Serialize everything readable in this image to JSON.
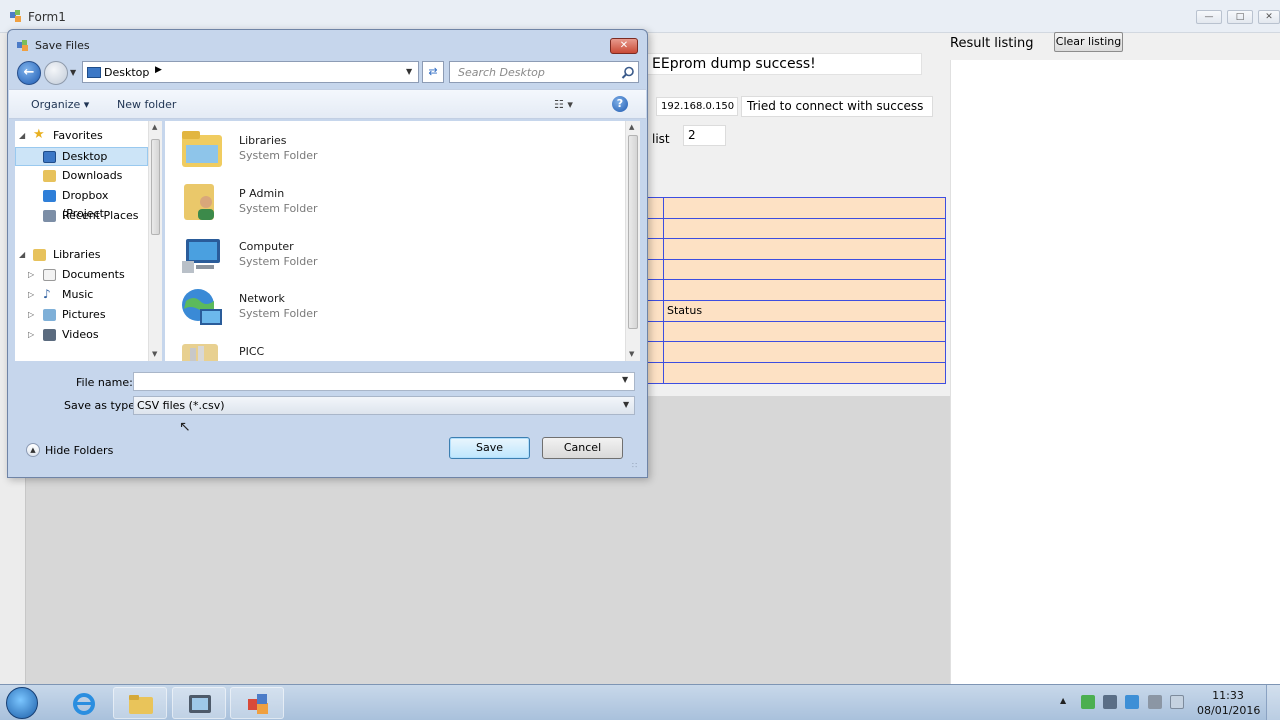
{
  "form1": {
    "title": "Form1",
    "status_message": "EEprom dump success!",
    "ip_address": "192.168.0.150",
    "connection_status": "Tried to connect with success",
    "list_label": "list",
    "list_value": "2",
    "grid_status_header": "Status",
    "result_label": "Result listing",
    "clear_button": "Clear listing"
  },
  "dialog": {
    "title": "Save Files",
    "address": "Desktop",
    "search_placeholder": "Search Desktop",
    "organize": "Organize",
    "new_folder": "New folder",
    "nav": {
      "favorites": "Favorites",
      "desktop": "Desktop",
      "downloads": "Downloads",
      "dropbox": "Dropbox (Project",
      "recent": "Recent Places",
      "libraries": "Libraries",
      "documents": "Documents",
      "music": "Music",
      "pictures": "Pictures",
      "videos": "Videos"
    },
    "files": [
      {
        "name": "Libraries",
        "type": "System Folder"
      },
      {
        "name": "P Admin",
        "type": "System Folder"
      },
      {
        "name": "Computer",
        "type": "System Folder"
      },
      {
        "name": "Network",
        "type": "System Folder"
      },
      {
        "name": "PICC",
        "type": ""
      }
    ],
    "file_name_label": "File name:",
    "file_name_value": "",
    "save_type_label": "Save as type:",
    "save_type_value": "CSV files (*.csv)",
    "hide_folders": "Hide Folders",
    "save_button": "Save",
    "cancel_button": "Cancel"
  },
  "taskbar": {
    "time": "11:33",
    "date": "08/01/2016"
  }
}
